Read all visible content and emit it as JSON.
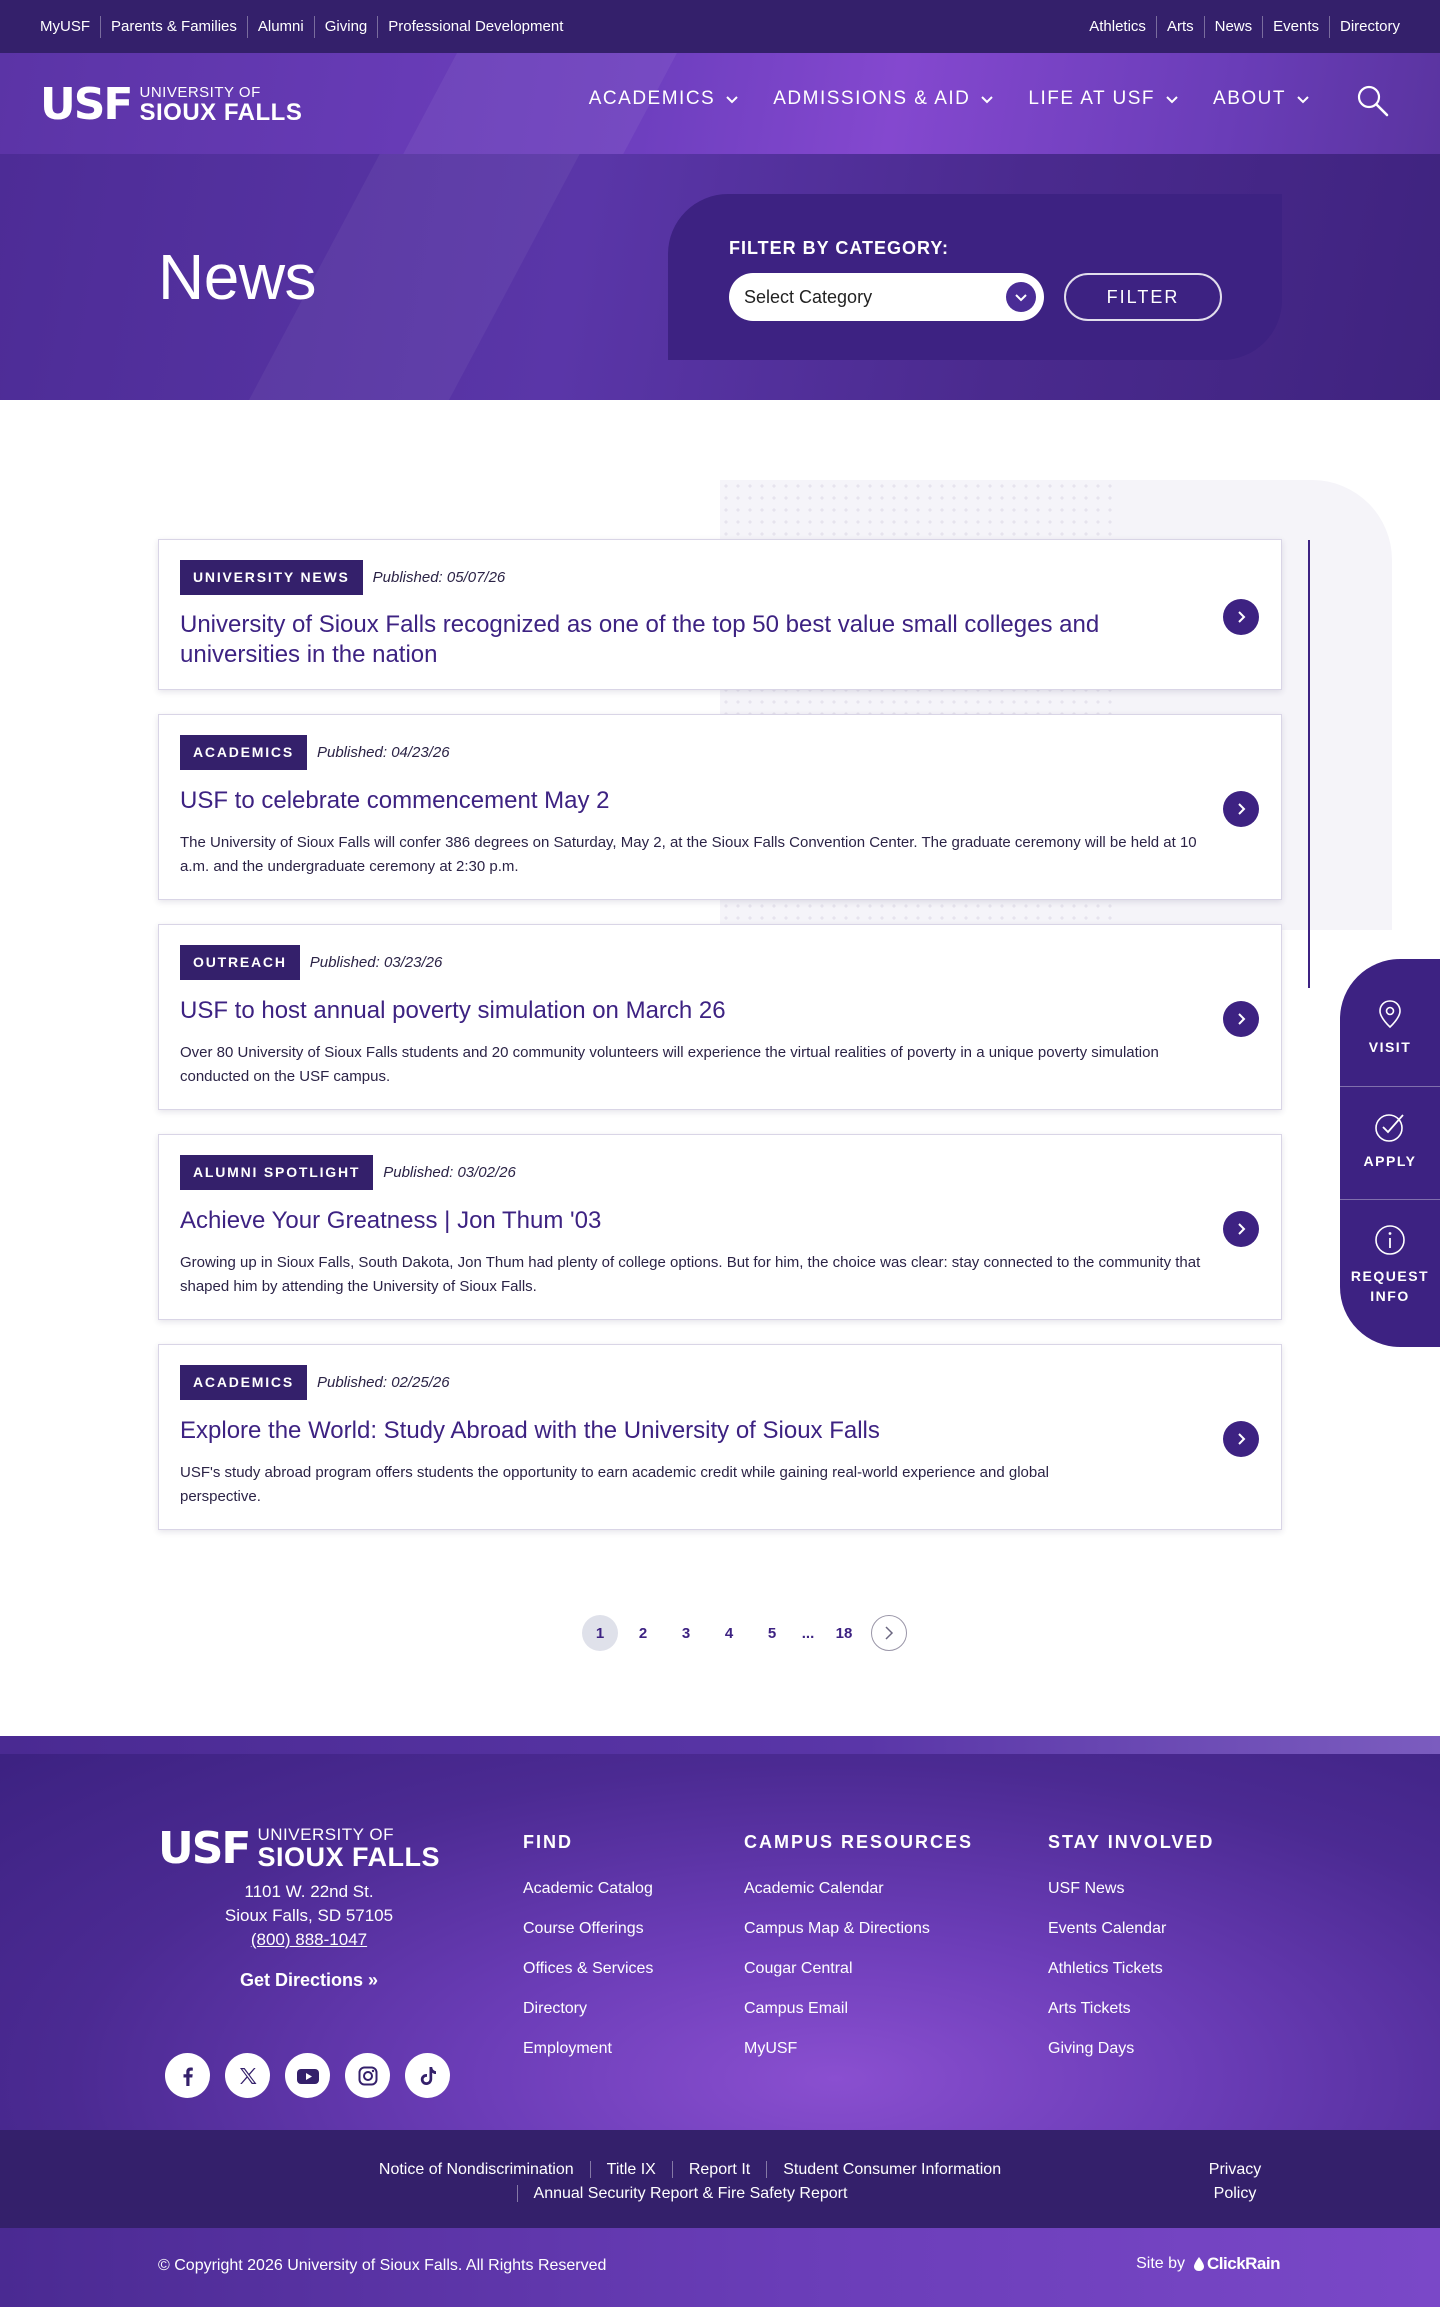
{
  "utility": {
    "left": [
      "MyUSF",
      "Parents & Families",
      "Alumni",
      "Giving",
      "Professional Development"
    ],
    "right": [
      "Athletics",
      "Arts",
      "News",
      "Events",
      "Directory"
    ]
  },
  "logo": {
    "mark": "USF",
    "line1": "UNIVERSITY OF",
    "line2": "SIOUX FALLS"
  },
  "nav": [
    "ACADEMICS",
    "ADMISSIONS & AID",
    "LIFE AT USF",
    "ABOUT"
  ],
  "search_icon": "search-icon",
  "hero": {
    "title": "News",
    "filter_label": "FILTER BY CATEGORY:",
    "select_value": "Select Category",
    "filter_button": "FILTER"
  },
  "articles": [
    {
      "category": "UNIVERSITY NEWS",
      "date": "Published: 05/07/26",
      "title": "University of Sioux Falls recognized as one of the top 50 best value small colleges and universities in the nation",
      "summary": ""
    },
    {
      "category": "ACADEMICS",
      "date": "Published: 04/23/26",
      "title": "USF to celebrate commencement May 2",
      "summary": "The University of Sioux Falls will confer 386 degrees on Saturday, May 2, at the Sioux Falls Convention Center. The graduate ceremony will be held at 10 a.m. and the undergraduate ceremony at 2:30 p.m."
    },
    {
      "category": "OUTREACH",
      "date": "Published: 03/23/26",
      "title": "USF to host annual poverty simulation on March 26",
      "summary": "Over 80 University of Sioux Falls students and 20 community volunteers will experience the virtual realities of poverty in a unique poverty simulation conducted on the USF campus."
    },
    {
      "category": "ALUMNI SPOTLIGHT",
      "date": "Published: 03/02/26",
      "title": "Achieve Your Greatness | Jon Thum '03",
      "summary": "Growing up in Sioux Falls, South Dakota, Jon Thum had plenty of college options. But for him, the choice was clear: stay connected to the community that shaped him by attending the University of Sioux Falls."
    },
    {
      "category": "ACADEMICS",
      "date": "Published: 02/25/26",
      "title": "Explore the World: Study Abroad with the University of Sioux Falls",
      "summary": "USF's study abroad program offers students the opportunity to earn academic credit while gaining real-world experience and global perspective."
    }
  ],
  "cta": {
    "visit": "VISIT",
    "apply": "APPLY",
    "request_line1": "REQUEST",
    "request_line2": "INFO"
  },
  "pagination": {
    "current": "1",
    "pages": [
      "1",
      "2",
      "3",
      "4",
      "5",
      "...",
      "18"
    ]
  },
  "footer": {
    "address1": "1101 W. 22nd St.",
    "address2": "Sioux Falls, SD 57105",
    "phone": "(800) 888-1047",
    "directions": "Get Directions »",
    "socials": [
      "facebook-icon",
      "x-icon",
      "youtube-icon",
      "instagram-icon",
      "tiktok-icon"
    ],
    "columns": [
      {
        "title": "FIND",
        "links": [
          "Academic Catalog",
          "Course Offerings",
          "Offices & Services",
          "Directory",
          "Employment"
        ]
      },
      {
        "title": "CAMPUS RESOURCES",
        "links": [
          "Academic Calendar",
          "Campus Map & Directions",
          "Cougar Central",
          "Campus Email",
          "MyUSF"
        ]
      },
      {
        "title": "STAY INVOLVED",
        "links": [
          "USF News",
          "Events Calendar",
          "Athletics Tickets",
          "Arts Tickets",
          "Giving Days"
        ]
      }
    ],
    "legal": [
      "Notice of Nondiscrimination",
      "Title IX",
      "Report It",
      "Student Consumer Information",
      "Annual Security Report & Fire Safety Report"
    ],
    "privacy_line1": "Privacy",
    "privacy_line2": "Policy",
    "copyright": "© Copyright 2026 University of Sioux Falls. All Rights Reserved",
    "siteby": "Site by",
    "siteby_brand": "ClickRain"
  },
  "colors": {
    "primary": "#3d2282",
    "dark": "#34206b",
    "accent": "#8448cf"
  }
}
